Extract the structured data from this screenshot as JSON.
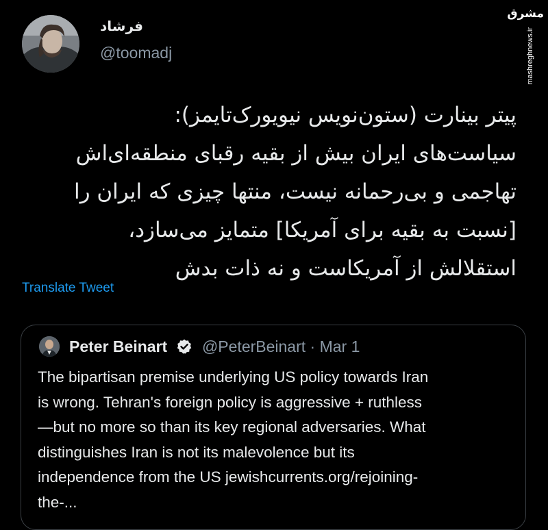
{
  "author": {
    "display_name": "فرشاد",
    "handle": "@toomadj"
  },
  "watermark": {
    "logo_text": "مشرق",
    "site": "mashreghnews.ir"
  },
  "tweet": {
    "lines": [
      "پیتر بینارت (ستون‌نویس نیویورک‌تایمز):",
      "سیاست‌های ایران بیش از بقیه رقبای منطقه‌ای‌اش",
      "تهاجمی و بی‌رحمانه نیست، منتها چیزی که ایران را",
      "[نسبت به بقیه برای آمریکا] متمایز می‌سازد،",
      "استقلالش از آمریکاست و نه ذات بدش"
    ],
    "translate_label": "Translate Tweet"
  },
  "quoted": {
    "name": "Peter Beinart",
    "handle": "@PeterBeinart",
    "separator": "·",
    "date": "Mar 1",
    "lines": [
      "The bipartisan premise underlying US policy towards Iran",
      "is wrong. Tehran's foreign policy is aggressive + ruthless",
      "—but no more so than its key regional adversaries. What",
      "distinguishes Iran is not its malevolence but its",
      "independence from the US  jewishcurrents.org/rejoining-",
      "the-..."
    ]
  }
}
